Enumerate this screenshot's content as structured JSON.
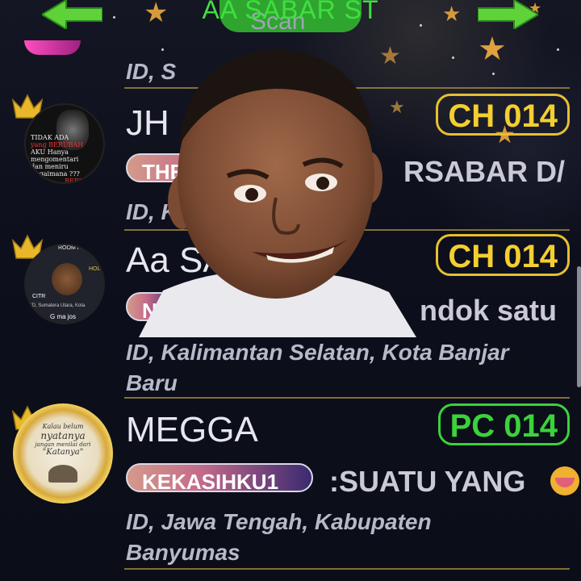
{
  "header": {
    "room_title": "AA SABAR ST",
    "scan_label": "Scan",
    "colors": {
      "green": "#3fe03f",
      "pill": "#2fa52f"
    }
  },
  "rows": [
    {
      "partial_id": "ID, S",
      "name": "JH",
      "badge": "CH 014",
      "tag": "THE",
      "status": "RSABAR D/",
      "location": "ID, K                          ta Pontianak",
      "avatar_text": [
        "TIDAK ADA",
        "yang BERUBAH",
        "AKU Hanya mengomentari",
        "dan meniru",
        "Bagaimana ???",
        "BERMAIN"
      ]
    },
    {
      "name": "Aa SA",
      "badge": "CH 014",
      "tag": "NE",
      "status": "ndok satu",
      "location_line1": "ID, Kalimantan Selatan, Kota Banjar",
      "location_line2": "Baru",
      "avatar_text": [
        "ROOM FRIEN",
        "HOL",
        "CITR",
        "ID, Sumatera Utara, Kota",
        "G ma jos"
      ]
    },
    {
      "name": "MEGGA",
      "badge": "PC 014",
      "tag": "KEKASIHKU1",
      "status": ":SUATU YANG",
      "location_line1": "ID, Jawa Tengah, Kabupaten",
      "location_line2": "Banyumas",
      "avatar_text": [
        "Kalau belum",
        "nyatanya",
        "jangan menilai dari",
        "\"Katanya\""
      ]
    }
  ],
  "icons": [
    "left-arrow-icon",
    "right-arrow-icon",
    "crown-icon",
    "star-icon",
    "emoji-icon"
  ],
  "colors": {
    "ch_badge": "#f3cf30",
    "pc_badge": "#3bd23b",
    "separator": "#a08a3a"
  }
}
